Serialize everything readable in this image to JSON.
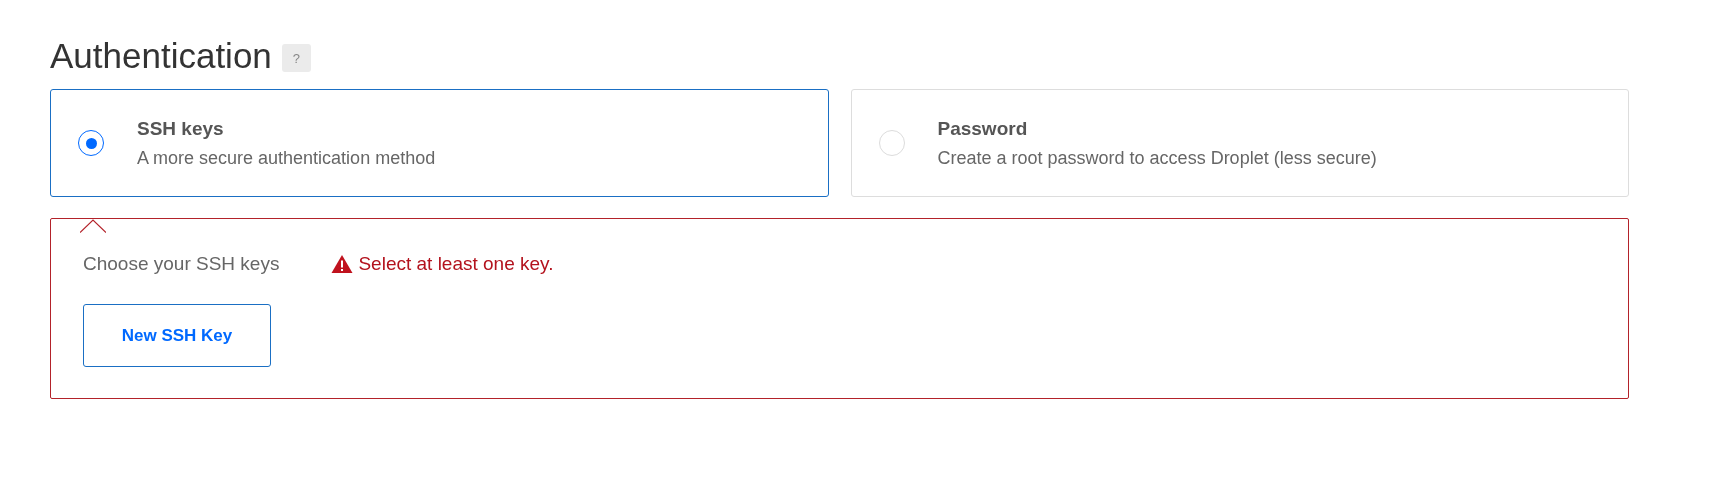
{
  "section": {
    "title": "Authentication",
    "help": "?"
  },
  "options": [
    {
      "title": "SSH keys",
      "description": "A more secure authentication method",
      "selected": true
    },
    {
      "title": "Password",
      "description": "Create a root password to access Droplet (less secure)",
      "selected": false
    }
  ],
  "key_panel": {
    "label": "Choose your SSH keys",
    "error": "Select at least one key.",
    "button": "New SSH Key"
  }
}
